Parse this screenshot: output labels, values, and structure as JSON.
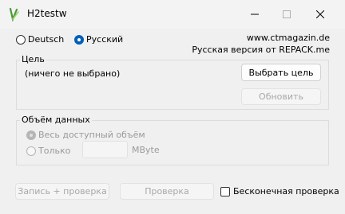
{
  "window": {
    "title": "H2testw",
    "icon": "h2testw-app-icon"
  },
  "language": {
    "options": [
      {
        "label": "Deutsch",
        "selected": false
      },
      {
        "label": "Русский",
        "selected": true
      }
    ]
  },
  "site": {
    "url": "www.ctmagazin.de",
    "note": "Русская версия от REPACK.me"
  },
  "target": {
    "group_label": "Цель",
    "value": "(ничего не выбрано)",
    "select_button": "Выбрать цель",
    "refresh_button": "Обновить"
  },
  "volume": {
    "group_label": "Объём данных",
    "all_label": "Весь доступный объём",
    "only_label": "Только",
    "unit": "MByte",
    "mbyte_value": ""
  },
  "actions": {
    "write_verify": "Запись + проверка",
    "verify": "Проверка",
    "endless": "Бесконечная проверка"
  }
}
